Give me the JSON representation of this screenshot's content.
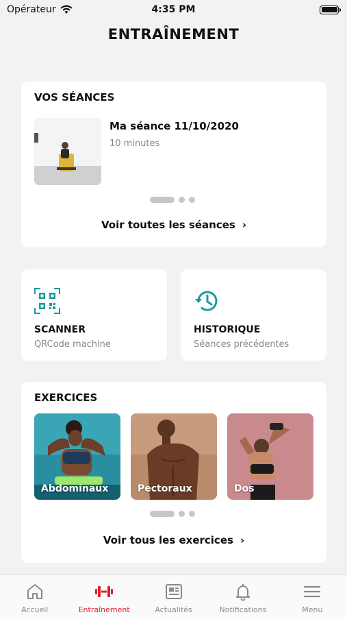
{
  "status_bar": {
    "carrier": "Opérateur",
    "time": "4:35 PM"
  },
  "page_title": "ENTRAÎNEMENT",
  "sessions": {
    "title": "VOS SÉANCES",
    "item": {
      "name": "Ma séance 11/10/2020",
      "duration": "10 minutes"
    },
    "see_all": "Voir toutes les séances"
  },
  "tiles": [
    {
      "title": "SCANNER",
      "subtitle": "QRCode machine",
      "icon": "qr-code-icon"
    },
    {
      "title": "HISTORIQUE",
      "subtitle": "Séances précédentes",
      "icon": "history-icon"
    }
  ],
  "exercises": {
    "title": "EXERCICES",
    "items": [
      {
        "label": "Abdominaux"
      },
      {
        "label": "Pectoraux"
      },
      {
        "label": "Dos"
      }
    ],
    "see_all": "Voir tous les exercices"
  },
  "tab_bar": {
    "tabs": [
      {
        "label": "Accueil",
        "icon": "home-icon"
      },
      {
        "label": "Entraînement",
        "icon": "dumbbell-icon",
        "active": true
      },
      {
        "label": "Actualités",
        "icon": "news-icon"
      },
      {
        "label": "Notifications",
        "icon": "bell-icon"
      },
      {
        "label": "Menu",
        "icon": "menu-icon"
      }
    ]
  },
  "colors": {
    "accent": "#d8232a",
    "teal": "#1a9aa0",
    "muted": "#8a8a8a",
    "background": "#f2f2f2"
  }
}
